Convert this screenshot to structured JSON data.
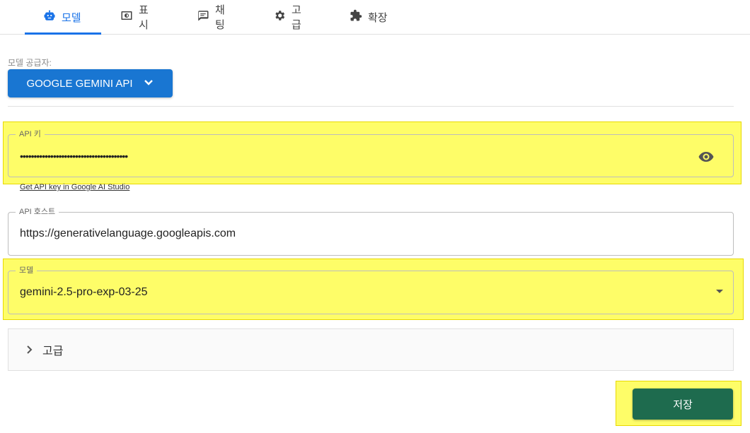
{
  "tabs": [
    {
      "label": "모델",
      "icon": "robot-icon",
      "active": true
    },
    {
      "label": "표시",
      "icon": "display-icon",
      "active": false
    },
    {
      "label": "채팅",
      "icon": "chat-icon",
      "active": false
    },
    {
      "label": "고급",
      "icon": "gear-icon",
      "active": false
    },
    {
      "label": "확장",
      "icon": "puzzle-icon",
      "active": false
    }
  ],
  "provider": {
    "label": "모델 공급자:",
    "selected": "GOOGLE GEMINI API"
  },
  "api_key": {
    "legend": "API 키",
    "value": "•••••••••••••••••••••••••••••••••••••••",
    "link": "Get API key in Google AI Studio"
  },
  "api_host": {
    "legend": "API 호스트",
    "value": "https://generativelanguage.googleapis.com"
  },
  "model": {
    "legend": "모델",
    "value": "gemini-2.5-pro-exp-03-25"
  },
  "advanced": {
    "label": "고급"
  },
  "save_label": "저장",
  "colors": {
    "accent": "#1a73e8",
    "provider_button": "#1976d2",
    "save_button": "#1e6b4e",
    "highlight": "#fefd68"
  }
}
